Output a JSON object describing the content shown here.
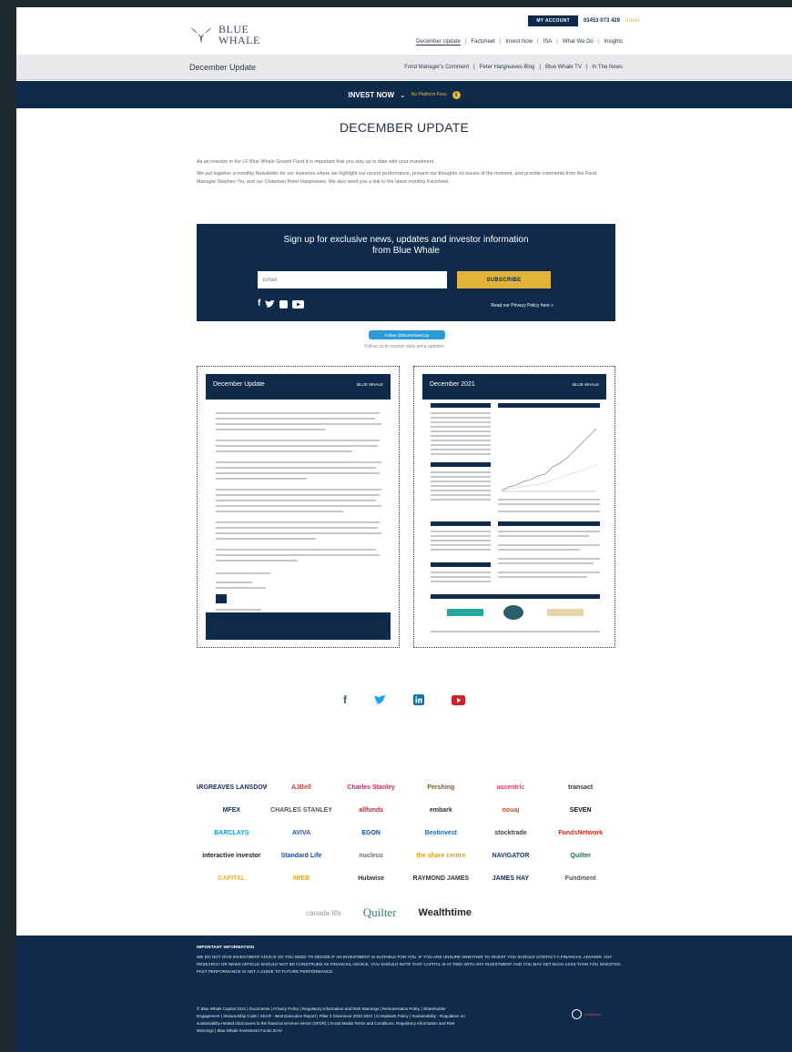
{
  "header": {
    "brand_line1": "BLUE",
    "brand_line2": "WHALE",
    "account_button": "MY ACCOUNT",
    "phone": "03453 073 429",
    "email_link": "Email",
    "nav": [
      "December Update",
      "Factsheet",
      "Invest Now",
      "ISA",
      "What We Do",
      "Insights"
    ]
  },
  "subbar": {
    "title": "December Update",
    "nav": [
      "Fund Manager's Comment",
      "Peter Hargreaves Blog",
      "Blue Whale TV",
      "In The News"
    ]
  },
  "invest_bar": {
    "label": "INVEST NOW",
    "note": "No Platform Fees"
  },
  "main": {
    "title": "DECEMBER UPDATE",
    "intro_p1": "As an investor in the LF Blue Whale Growth Fund it is important that you stay up to date with your investment.",
    "intro_p2": "We put together a monthly Newsletter for our investors where we highlight our recent performance, present our thoughts on issues of the moment, and provide comments from the Fund Manager Stephen Yiu, and our Chairman Peter Hargreaves. We also send you a link to the latest monthly Factsheet."
  },
  "signup": {
    "heading_line1": "Sign up for exclusive news, updates and investor information",
    "heading_line2": "from Blue Whale",
    "email_placeholder": "Email",
    "subscribe_button": "SUBSCRIBE",
    "privacy_link": "Read our Privacy Policy here »"
  },
  "twitter": {
    "button": "Follow @BlueWhaleCap",
    "subtext": "Follow us to receive daily price updates"
  },
  "documents": [
    {
      "title": "December Update",
      "logo_text": "BLUE WHALE"
    },
    {
      "title": "December 2021",
      "logo_text": "BLUE WHALE"
    }
  ],
  "partners": [
    "HARGREAVES LANSDOWN",
    "AJBell",
    "Charles Stanley",
    "Pershing",
    "ascentric",
    "transact",
    "MFEX",
    "CHARLES STANLEY",
    "allfunds",
    "embark",
    "nouaj",
    "SEVEN",
    "BARCLAYS",
    "AVIVA",
    "EGON",
    "Bestinvest",
    "stocktrade",
    "FundsNetwork",
    "interactive investor",
    "Standard Life",
    "nucleus",
    "the share centre",
    "NAVIGATOR",
    "Quilter",
    "CAPITAL",
    "iWEB",
    "Hubwise",
    "RAYMOND JAMES",
    "JAMES HAY",
    "Fundment"
  ],
  "partners_last": [
    "canada life",
    "Quilter",
    "Wealthtime"
  ],
  "footer": {
    "important_heading": "IMPORTANT INFORMATION",
    "important_text": "We do not give investment advice so you need to decide if an investment is suitable for you. If you are unsure whether to invest you should contact a financial adviser. Any research or news article should not be construed as financial advice. You should note that capital is at risk with any investment and you may get back less than you invested. Past performance is not a guide to future performance.",
    "legal_text": "© Blue Whale Capital 2021 | Documents | Privacy Policy | Regulatory Information and Risk Warnings | Remuneration Policy | Shareholder Engagement | Stewardship Code | SECR - Best Execution Report | Pillar 3 Disclosure 2020-2021 | Complaints Policy | Sustainability - Regulation on sustainability-related disclosures in the financial services sector (SFDR) | Social Media Terms and Conditions, Regulatory Information and Risk Warnings | Blue Whale Investment Funds ICAV",
    "badge": "A Member"
  }
}
